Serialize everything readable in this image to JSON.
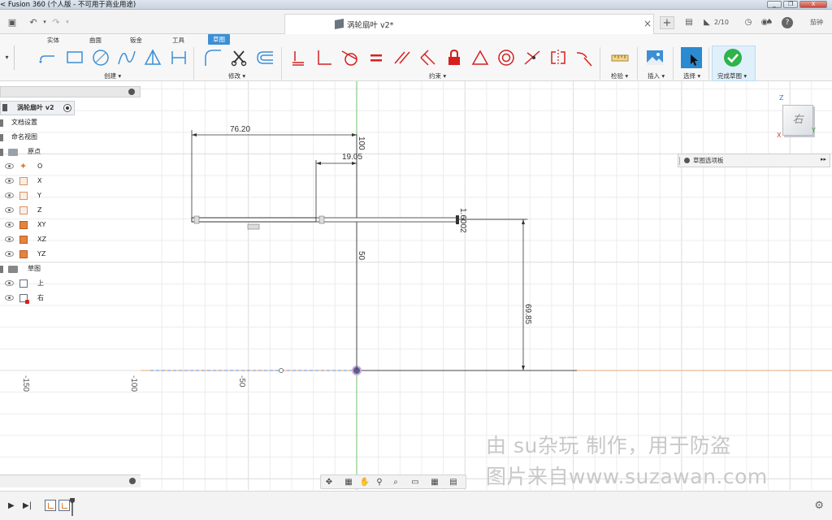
{
  "window": {
    "title": "< Fusion 360 (个人版 - 不可用于商业用途)",
    "minimize": "_",
    "restore": "❐",
    "close": "X"
  },
  "quickbar": {
    "doc_title": "涡轮扇叶 v2*",
    "jobs_count": "2/10",
    "user": "茄钟"
  },
  "ribbon": {
    "tabs": [
      "实体",
      "曲面",
      "钣金",
      "工具",
      "草图"
    ],
    "active_tab": "草图",
    "groups": {
      "create": "创建 ▾",
      "modify": "修改 ▾",
      "constraints": "约束 ▾",
      "inspect": "检验 ▾",
      "insert": "插入 ▾",
      "select": "选择 ▾",
      "finish": "完成草图 ▾"
    }
  },
  "browser": {
    "root": "涡轮扇叶 v2",
    "items": [
      {
        "label": "文档设置"
      },
      {
        "label": "命名视图"
      },
      {
        "label": "原点"
      },
      {
        "label": "O"
      },
      {
        "label": "X"
      },
      {
        "label": "Y"
      },
      {
        "label": "Z"
      },
      {
        "label": "XY"
      },
      {
        "label": "XZ"
      },
      {
        "label": "YZ"
      },
      {
        "label": "草图"
      },
      {
        "label": "上"
      },
      {
        "label": "右"
      }
    ]
  },
  "palette": {
    "label": "草图选项板",
    "arrows": "▸▸"
  },
  "viewcube": {
    "face": "右",
    "axis_z": "Z",
    "axis_y": "Y",
    "axis_x": "X"
  },
  "sketch": {
    "dims": {
      "d1": "76.20",
      "d2": "19.05",
      "d3": "100",
      "d4": "50",
      "d5": "1.6002",
      "d6": "69.85"
    },
    "ruler": [
      "-150",
      "-100",
      "-50"
    ]
  },
  "watermark": {
    "line1": "由 su杂玩 制作，用于防盗",
    "line2": "图片来自www.suzawan.com"
  },
  "colors": {
    "accent": "#3c8fd5",
    "finish_green": "#2fb34a",
    "constraint_red": "#d62020",
    "axis_green": "#6fc26f",
    "axis_orange": "#e6a87a"
  }
}
